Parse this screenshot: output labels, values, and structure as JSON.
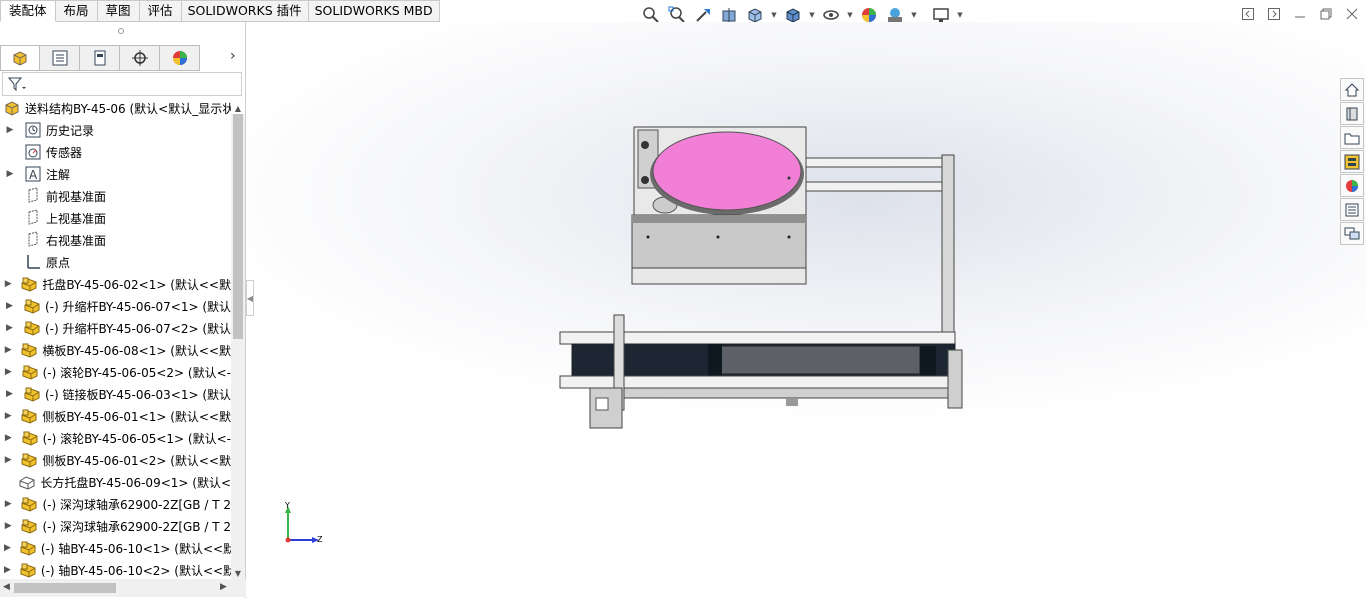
{
  "tabs": [
    {
      "label": "装配体",
      "active": true
    },
    {
      "label": "布局"
    },
    {
      "label": "草图"
    },
    {
      "label": "评估"
    },
    {
      "label": "SOLIDWORKS 插件"
    },
    {
      "label": "SOLIDWORKS MBD"
    }
  ],
  "hud_icons": [
    "zoom-to-fit-icon",
    "zoom-to-area-icon",
    "previous-view-icon",
    "section-view-icon",
    "view-orientation-icon",
    "display-style-icon",
    "hide-show-items-icon",
    "edit-appearance-icon",
    "apply-scene-icon",
    "view-settings-icon"
  ],
  "tree": {
    "root": "送料结构BY-45-06  (默认<默认_显示状",
    "items": [
      {
        "label": "历史记录",
        "icon": "history-icon",
        "expandable": true
      },
      {
        "label": "传感器",
        "icon": "sensor-icon",
        "expandable": false
      },
      {
        "label": "注解",
        "icon": "annotation-icon",
        "expandable": true
      },
      {
        "label": "前视基准面",
        "icon": "plane-icon",
        "expandable": false
      },
      {
        "label": "上视基准面",
        "icon": "plane-icon",
        "expandable": false
      },
      {
        "label": "右视基准面",
        "icon": "plane-icon",
        "expandable": false
      },
      {
        "label": "原点",
        "icon": "origin-icon",
        "expandable": false
      },
      {
        "label": "托盘BY-45-06-02<1> (默认<<默",
        "icon": "part-icon",
        "expandable": true
      },
      {
        "label": "(-) 升缩杆BY-45-06-07<1> (默认",
        "icon": "part-icon",
        "expandable": true
      },
      {
        "label": "(-) 升缩杆BY-45-06-07<2> (默认",
        "icon": "part-icon",
        "expandable": true
      },
      {
        "label": "横板BY-45-06-08<1> (默认<<默",
        "icon": "part-icon",
        "expandable": true
      },
      {
        "label": "(-) 滚轮BY-45-06-05<2> (默认<-",
        "icon": "part-icon",
        "expandable": true
      },
      {
        "label": "(-) 链接板BY-45-06-03<1> (默认",
        "icon": "part-icon",
        "expandable": true
      },
      {
        "label": "侧板BY-45-06-01<1> (默认<<默",
        "icon": "part-icon",
        "expandable": true
      },
      {
        "label": "(-) 滚轮BY-45-06-05<1> (默认<-",
        "icon": "part-icon",
        "expandable": true
      },
      {
        "label": "侧板BY-45-06-01<2> (默认<<默",
        "icon": "part-icon",
        "expandable": true
      },
      {
        "label": "长方托盘BY-45-06-09<1> (默认<",
        "icon": "part-outline-icon",
        "expandable": false
      },
      {
        "label": "(-) 深沟球轴承62900-2Z[GB / T 2",
        "icon": "part-icon",
        "expandable": true
      },
      {
        "label": "(-) 深沟球轴承62900-2Z[GB / T 2",
        "icon": "part-icon",
        "expandable": true
      },
      {
        "label": "(-) 轴BY-45-06-10<1> (默认<<默",
        "icon": "part-icon",
        "expandable": true
      },
      {
        "label": "(-) 轴BY-45-06-10<2> (默认<<默",
        "icon": "part-icon",
        "expandable": true
      }
    ]
  },
  "triad": {
    "x": "Z",
    "y": "Y"
  },
  "colors": {
    "tray_pink": "#f27fd6",
    "frame_gray": "#bdbdbd",
    "cylinder_dark": "#1c2733"
  }
}
